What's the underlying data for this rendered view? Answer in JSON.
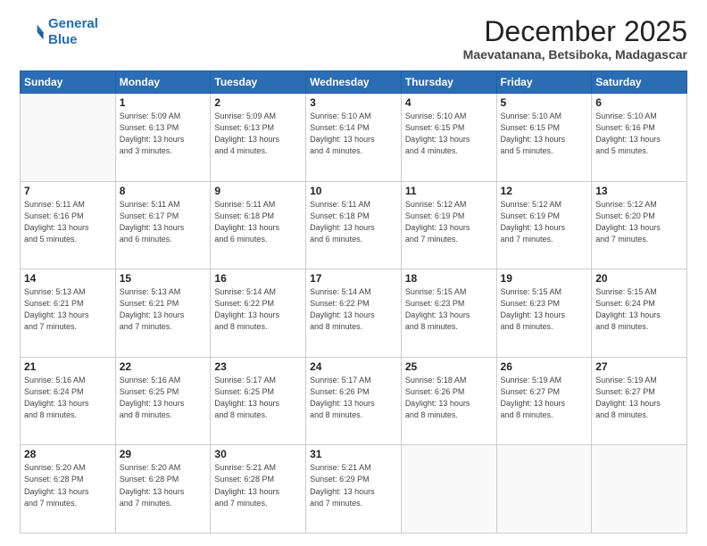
{
  "logo": {
    "line1": "General",
    "line2": "Blue"
  },
  "title": "December 2025",
  "subtitle": "Maevatanana, Betsiboka, Madagascar",
  "weekdays": [
    "Sunday",
    "Monday",
    "Tuesday",
    "Wednesday",
    "Thursday",
    "Friday",
    "Saturday"
  ],
  "weeks": [
    [
      {
        "day": "",
        "info": ""
      },
      {
        "day": "1",
        "info": "Sunrise: 5:09 AM\nSunset: 6:13 PM\nDaylight: 13 hours\nand 3 minutes."
      },
      {
        "day": "2",
        "info": "Sunrise: 5:09 AM\nSunset: 6:13 PM\nDaylight: 13 hours\nand 4 minutes."
      },
      {
        "day": "3",
        "info": "Sunrise: 5:10 AM\nSunset: 6:14 PM\nDaylight: 13 hours\nand 4 minutes."
      },
      {
        "day": "4",
        "info": "Sunrise: 5:10 AM\nSunset: 6:15 PM\nDaylight: 13 hours\nand 4 minutes."
      },
      {
        "day": "5",
        "info": "Sunrise: 5:10 AM\nSunset: 6:15 PM\nDaylight: 13 hours\nand 5 minutes."
      },
      {
        "day": "6",
        "info": "Sunrise: 5:10 AM\nSunset: 6:16 PM\nDaylight: 13 hours\nand 5 minutes."
      }
    ],
    [
      {
        "day": "7",
        "info": "Sunrise: 5:11 AM\nSunset: 6:16 PM\nDaylight: 13 hours\nand 5 minutes."
      },
      {
        "day": "8",
        "info": "Sunrise: 5:11 AM\nSunset: 6:17 PM\nDaylight: 13 hours\nand 6 minutes."
      },
      {
        "day": "9",
        "info": "Sunrise: 5:11 AM\nSunset: 6:18 PM\nDaylight: 13 hours\nand 6 minutes."
      },
      {
        "day": "10",
        "info": "Sunrise: 5:11 AM\nSunset: 6:18 PM\nDaylight: 13 hours\nand 6 minutes."
      },
      {
        "day": "11",
        "info": "Sunrise: 5:12 AM\nSunset: 6:19 PM\nDaylight: 13 hours\nand 7 minutes."
      },
      {
        "day": "12",
        "info": "Sunrise: 5:12 AM\nSunset: 6:19 PM\nDaylight: 13 hours\nand 7 minutes."
      },
      {
        "day": "13",
        "info": "Sunrise: 5:12 AM\nSunset: 6:20 PM\nDaylight: 13 hours\nand 7 minutes."
      }
    ],
    [
      {
        "day": "14",
        "info": "Sunrise: 5:13 AM\nSunset: 6:21 PM\nDaylight: 13 hours\nand 7 minutes."
      },
      {
        "day": "15",
        "info": "Sunrise: 5:13 AM\nSunset: 6:21 PM\nDaylight: 13 hours\nand 7 minutes."
      },
      {
        "day": "16",
        "info": "Sunrise: 5:14 AM\nSunset: 6:22 PM\nDaylight: 13 hours\nand 8 minutes."
      },
      {
        "day": "17",
        "info": "Sunrise: 5:14 AM\nSunset: 6:22 PM\nDaylight: 13 hours\nand 8 minutes."
      },
      {
        "day": "18",
        "info": "Sunrise: 5:15 AM\nSunset: 6:23 PM\nDaylight: 13 hours\nand 8 minutes."
      },
      {
        "day": "19",
        "info": "Sunrise: 5:15 AM\nSunset: 6:23 PM\nDaylight: 13 hours\nand 8 minutes."
      },
      {
        "day": "20",
        "info": "Sunrise: 5:15 AM\nSunset: 6:24 PM\nDaylight: 13 hours\nand 8 minutes."
      }
    ],
    [
      {
        "day": "21",
        "info": "Sunrise: 5:16 AM\nSunset: 6:24 PM\nDaylight: 13 hours\nand 8 minutes."
      },
      {
        "day": "22",
        "info": "Sunrise: 5:16 AM\nSunset: 6:25 PM\nDaylight: 13 hours\nand 8 minutes."
      },
      {
        "day": "23",
        "info": "Sunrise: 5:17 AM\nSunset: 6:25 PM\nDaylight: 13 hours\nand 8 minutes."
      },
      {
        "day": "24",
        "info": "Sunrise: 5:17 AM\nSunset: 6:26 PM\nDaylight: 13 hours\nand 8 minutes."
      },
      {
        "day": "25",
        "info": "Sunrise: 5:18 AM\nSunset: 6:26 PM\nDaylight: 13 hours\nand 8 minutes."
      },
      {
        "day": "26",
        "info": "Sunrise: 5:19 AM\nSunset: 6:27 PM\nDaylight: 13 hours\nand 8 minutes."
      },
      {
        "day": "27",
        "info": "Sunrise: 5:19 AM\nSunset: 6:27 PM\nDaylight: 13 hours\nand 8 minutes."
      }
    ],
    [
      {
        "day": "28",
        "info": "Sunrise: 5:20 AM\nSunset: 6:28 PM\nDaylight: 13 hours\nand 7 minutes."
      },
      {
        "day": "29",
        "info": "Sunrise: 5:20 AM\nSunset: 6:28 PM\nDaylight: 13 hours\nand 7 minutes."
      },
      {
        "day": "30",
        "info": "Sunrise: 5:21 AM\nSunset: 6:28 PM\nDaylight: 13 hours\nand 7 minutes."
      },
      {
        "day": "31",
        "info": "Sunrise: 5:21 AM\nSunset: 6:29 PM\nDaylight: 13 hours\nand 7 minutes."
      },
      {
        "day": "",
        "info": ""
      },
      {
        "day": "",
        "info": ""
      },
      {
        "day": "",
        "info": ""
      }
    ]
  ]
}
